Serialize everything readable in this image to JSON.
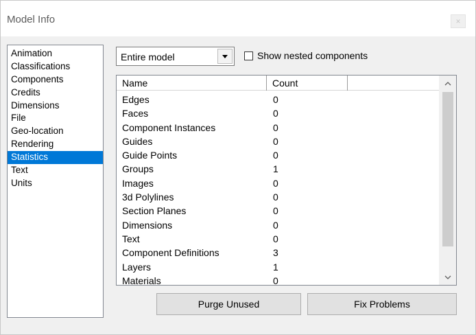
{
  "window": {
    "title": "Model Info",
    "close_glyph": "×"
  },
  "sidebar": {
    "items": [
      {
        "label": "Animation"
      },
      {
        "label": "Classifications"
      },
      {
        "label": "Components"
      },
      {
        "label": "Credits"
      },
      {
        "label": "Dimensions"
      },
      {
        "label": "File"
      },
      {
        "label": "Geo-location"
      },
      {
        "label": "Rendering"
      },
      {
        "label": "Statistics",
        "selected": true
      },
      {
        "label": "Text"
      },
      {
        "label": "Units"
      }
    ]
  },
  "scope": {
    "selected": "Entire model"
  },
  "nested": {
    "label": "Show nested components",
    "checked": false
  },
  "table": {
    "headers": {
      "name": "Name",
      "count": "Count"
    },
    "rows": [
      {
        "name": "Edges",
        "count": "0"
      },
      {
        "name": "Faces",
        "count": "0"
      },
      {
        "name": "Component Instances",
        "count": "0"
      },
      {
        "name": "Guides",
        "count": "0"
      },
      {
        "name": "Guide Points",
        "count": "0"
      },
      {
        "name": "Groups",
        "count": "1"
      },
      {
        "name": "Images",
        "count": "0"
      },
      {
        "name": "3d Polylines",
        "count": "0"
      },
      {
        "name": "Section Planes",
        "count": "0"
      },
      {
        "name": "Dimensions",
        "count": "0"
      },
      {
        "name": "Text",
        "count": "0"
      },
      {
        "name": "Component Definitions",
        "count": "3"
      },
      {
        "name": "Layers",
        "count": "1"
      },
      {
        "name": "Materials",
        "count": "0"
      }
    ]
  },
  "buttons": {
    "purge_label": "Purge Unused",
    "fix_label": "Fix Problems"
  },
  "colors": {
    "selection": "#0078d7",
    "dialog_bg": "#f0f0f0"
  },
  "icons": {
    "scroll_up": "chevron-up-icon",
    "scroll_down": "chevron-down-icon",
    "dropdown": "dropdown-arrow-icon"
  }
}
